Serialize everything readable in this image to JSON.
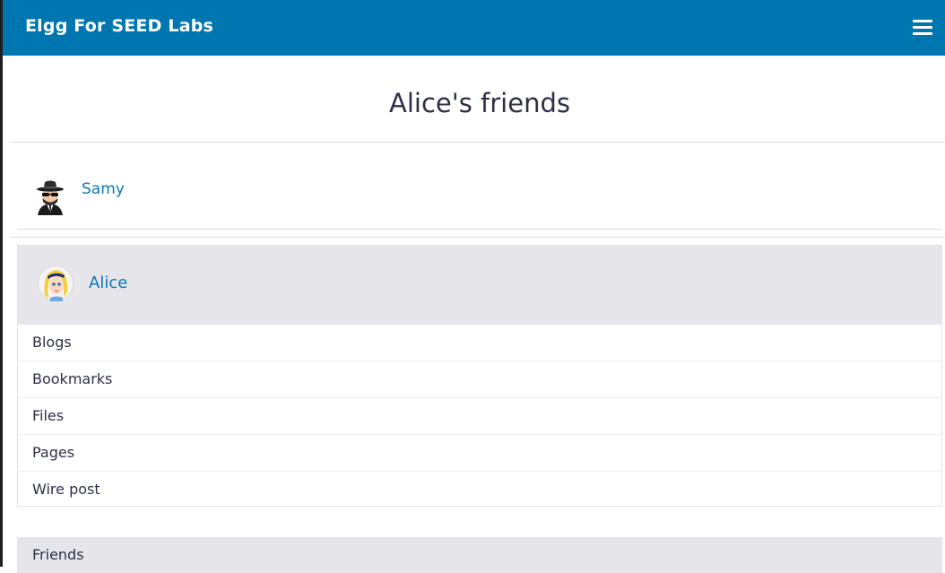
{
  "site": {
    "name": "Elgg For SEED Labs",
    "menu_icon": "hamburger-menu-icon"
  },
  "page": {
    "title": "Alice's friends"
  },
  "friends": [
    {
      "name": "Samy",
      "avatar_icon": "spy-avatar-icon"
    }
  ],
  "owner": {
    "name": "Alice",
    "avatar_icon": "alice-avatar-icon",
    "menu": [
      {
        "label": "Blogs"
      },
      {
        "label": "Bookmarks"
      },
      {
        "label": "Files"
      },
      {
        "label": "Pages"
      },
      {
        "label": "Wire post"
      }
    ]
  },
  "sidebar": {
    "friends_label": "Friends"
  },
  "colors": {
    "topbar": "#0076b0",
    "link": "#0a77b3",
    "panel": "#e6e6ea",
    "text": "#2d3047"
  }
}
